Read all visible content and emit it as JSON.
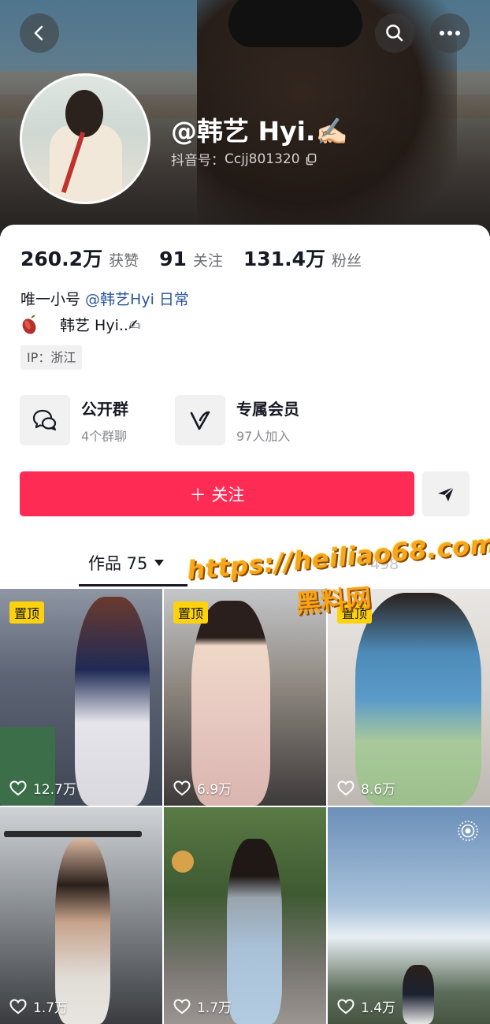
{
  "header": {
    "nickname": "@韩艺 Hyi.✍🏻",
    "douyin_id_label": "抖音号：",
    "douyin_id": "Ccjj801320"
  },
  "icons": {
    "back": "back-arrow-icon",
    "search": "search-icon",
    "more": "more-icon",
    "copy": "copy-icon",
    "group": "chat-bubbles-icon",
    "member": "member-v-icon",
    "send": "send-icon",
    "dropdown": "triangle-down-icon",
    "heart": "heart-outline-icon",
    "live": "live-icon"
  },
  "stats": [
    {
      "value": "260.2万",
      "label": "获赞"
    },
    {
      "value": "91",
      "label": "关注"
    },
    {
      "value": "131.4万",
      "label": "粉丝"
    }
  ],
  "bio": {
    "line1_prefix": "唯一小号 ",
    "line1_mention": "@韩艺Hyi 日常",
    "line2_text": "韩艺 Hyi..✍"
  },
  "ip": "IP：浙江",
  "groups": [
    {
      "title": "公开群",
      "subtitle": "4个群聊"
    },
    {
      "title": "专属会员",
      "subtitle": "97人加入"
    }
  ],
  "follow_button": "＋ 关注",
  "tabs": {
    "works_label": "作品 75",
    "faded_label": "498"
  },
  "watermark": {
    "url": "https://heiliao68.com",
    "cn": "黑料网"
  },
  "videos": [
    {
      "pinned": "置顶",
      "likes": "12.7万"
    },
    {
      "pinned": "置顶",
      "likes": "6.9万"
    },
    {
      "pinned": "置顶",
      "likes": "8.6万"
    },
    {
      "pinned": "",
      "likes": "1.7万"
    },
    {
      "pinned": "",
      "likes": "1.7万"
    },
    {
      "pinned": "",
      "likes": "1.4万"
    }
  ],
  "colors": {
    "follow": "#fe2c55",
    "mention": "#2b5599",
    "pin": "#fcd10d",
    "watermark": "#f7a51c"
  }
}
